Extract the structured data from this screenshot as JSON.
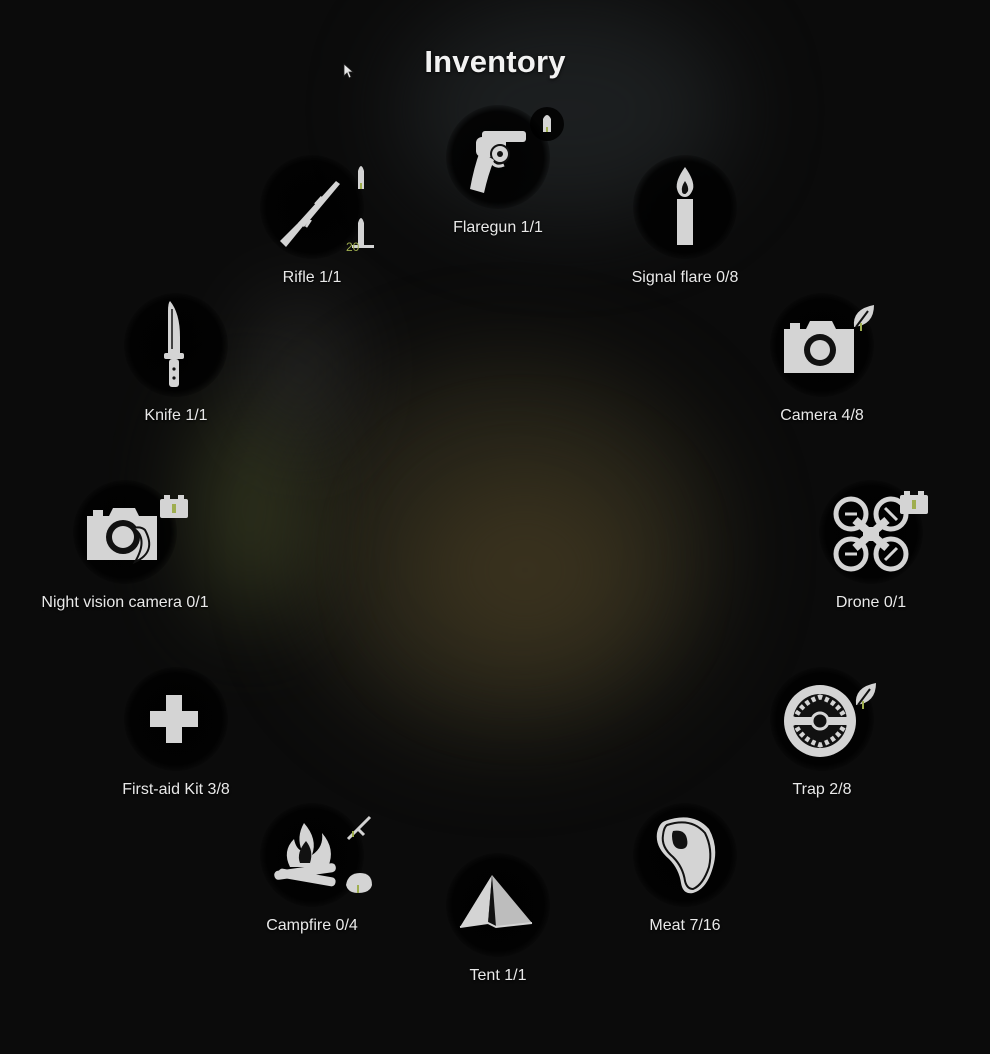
{
  "title": "Inventory",
  "colors": {
    "icon": "#d4d4d4",
    "accent": "#9fae4f",
    "label": "#e9e9e9"
  },
  "items": [
    {
      "name": "Flaregun",
      "count": "1/1",
      "label": "Flaregun 1/1",
      "icon": "revolver-icon",
      "badge": "bullet-icon"
    },
    {
      "name": "Signal flare",
      "count": "0/8",
      "label": "Signal flare 0/8",
      "icon": "flare-candle-icon",
      "badge": ""
    },
    {
      "name": "Camera",
      "count": "4/8",
      "label": "Camera 4/8",
      "icon": "camera-icon",
      "badge": "leaf-icon"
    },
    {
      "name": "Drone",
      "count": "0/1",
      "label": "Drone 0/1",
      "icon": "drone-icon",
      "badge": "battery-icon"
    },
    {
      "name": "Trap",
      "count": "2/8",
      "label": "Trap 2/8",
      "icon": "trap-icon",
      "badge": "leaf-icon"
    },
    {
      "name": "Meat",
      "count": "7/16",
      "label": "Meat 7/16",
      "icon": "meat-icon",
      "badge": ""
    },
    {
      "name": "Tent",
      "count": "1/1",
      "label": "Tent 1/1",
      "icon": "tent-icon",
      "badge": ""
    },
    {
      "name": "Campfire",
      "count": "0/4",
      "label": "Campfire 0/4",
      "icon": "campfire-icon",
      "badge": "stick-stone-icon"
    },
    {
      "name": "First-aid Kit",
      "count": "3/8",
      "label": "First-aid Kit 3/8",
      "icon": "first-aid-cross-icon",
      "badge": ""
    },
    {
      "name": "Night vision camera",
      "count": "0/1",
      "label": "Night vision camera 0/1",
      "icon": "night-vision-camera-icon",
      "badge": "battery-icon"
    },
    {
      "name": "Knife",
      "count": "1/1",
      "label": "Knife 1/1",
      "icon": "knife-icon",
      "badge": ""
    },
    {
      "name": "Rifle",
      "count": "1/1",
      "label": "Rifle 1/1",
      "icon": "rifle-icon",
      "badge": "rifle-ammo-icon",
      "badge_text": "20"
    }
  ]
}
